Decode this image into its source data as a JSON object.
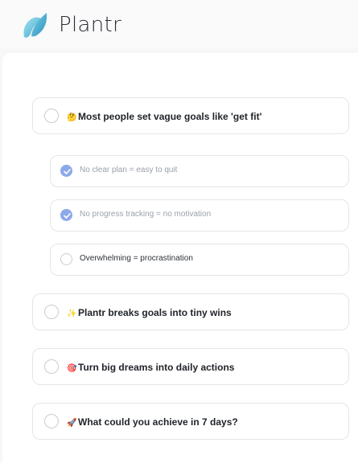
{
  "app": {
    "name": "Plantr",
    "brand_colors": [
      "#7fd3e6",
      "#3aa6cf"
    ],
    "accent": "#8da9ea"
  },
  "items": [
    {
      "emoji": "🤔",
      "text": "Most people set vague goals like 'get fit'",
      "checked": false
    },
    {
      "text": "No clear plan = easy to quit",
      "checked": true
    },
    {
      "text": "No progress tracking = no motivation",
      "checked": true
    },
    {
      "text": "Overwhelming = procrastination",
      "checked": false
    },
    {
      "emoji": "✨",
      "text": "Plantr breaks goals into tiny wins",
      "checked": false
    },
    {
      "emoji": "🎯",
      "text": "Turn big dreams into daily actions",
      "checked": false
    },
    {
      "emoji": "🚀",
      "text": "What could you achieve in 7 days?",
      "checked": false
    }
  ]
}
